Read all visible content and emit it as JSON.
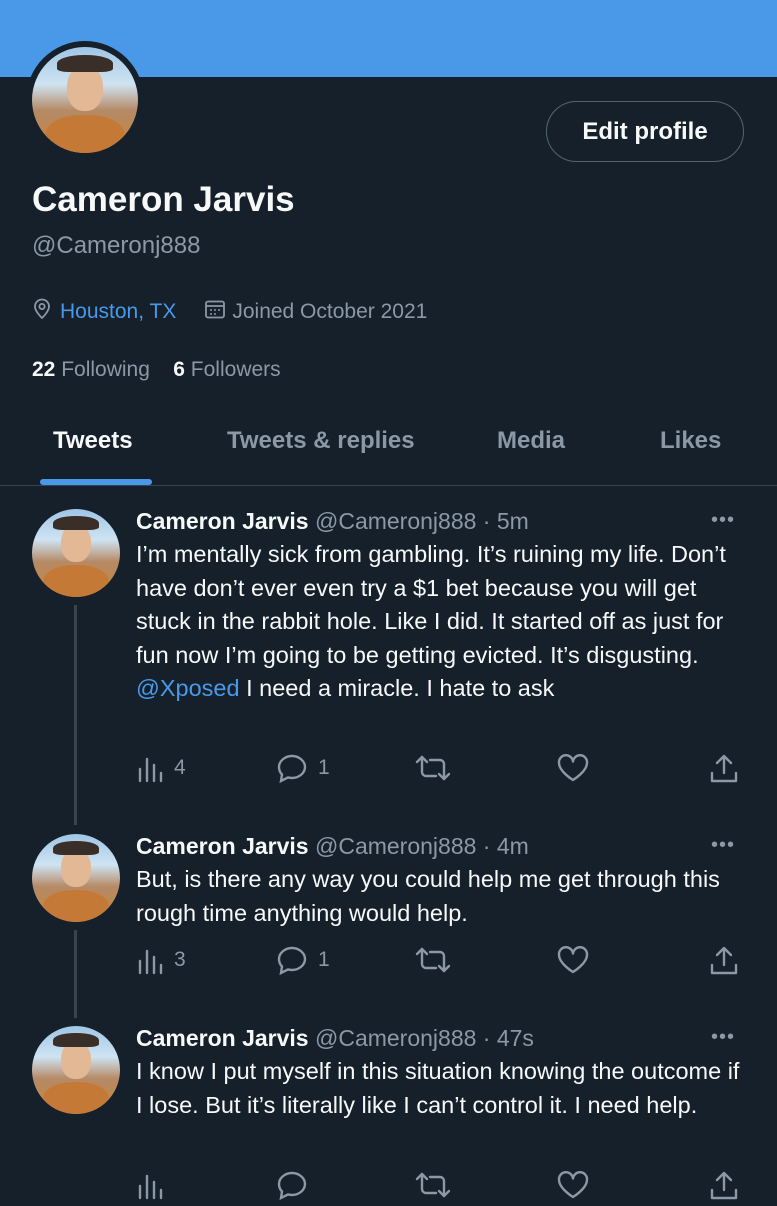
{
  "profile": {
    "name": "Cameron Jarvis",
    "handle": "@Cameronj888",
    "location": "Houston, TX",
    "joined": "Joined October 2021",
    "following_count": "22",
    "following_label": "Following",
    "followers_count": "6",
    "followers_label": "Followers",
    "edit_label": "Edit profile"
  },
  "tabs": [
    {
      "label": "Tweets",
      "active": true
    },
    {
      "label": "Tweets & replies"
    },
    {
      "label": "Media"
    },
    {
      "label": "Likes"
    }
  ],
  "tweets": [
    {
      "name": "Cameron Jarvis",
      "handle": "@Cameronj888 · 5m",
      "text_before": "I’m mentally sick from gambling. It’s ruining my life. Don’t have don’t ever even try a $1 bet because you will get stuck in the rabbit hole. Like I did. It started off as just for fun now I’m going to be getting evicted. It’s disgusting. ",
      "mention": "@Xposed",
      "text_after": " I need a miracle. I hate to ask",
      "views": "4",
      "replies": "1"
    },
    {
      "name": "Cameron Jarvis",
      "handle": "@Cameronj888 · 4m",
      "text_before": "But, is there any way you could help me get through this rough time anything would help.",
      "mention": "",
      "text_after": "",
      "views": "3",
      "replies": "1"
    },
    {
      "name": "Cameron Jarvis",
      "handle": "@Cameronj888 · 47s",
      "text_before": "I know I put myself in this situation knowing the outcome if I lose. But it’s literally like I can’t control it. I need help.",
      "mention": "",
      "text_after": "",
      "views": "",
      "replies": ""
    }
  ],
  "more_glyph": "•••",
  "colors": {
    "background": "#15202b",
    "banner": "#4a99e9",
    "accent": "#4a99e9",
    "muted_text": "#8b98a5",
    "primary_text": "#f7f9f9",
    "divider": "#38444d"
  },
  "icons": [
    "location-pin-icon",
    "calendar-icon",
    "views-icon",
    "reply-icon",
    "retweet-icon",
    "like-icon",
    "share-icon",
    "more-icon"
  ]
}
